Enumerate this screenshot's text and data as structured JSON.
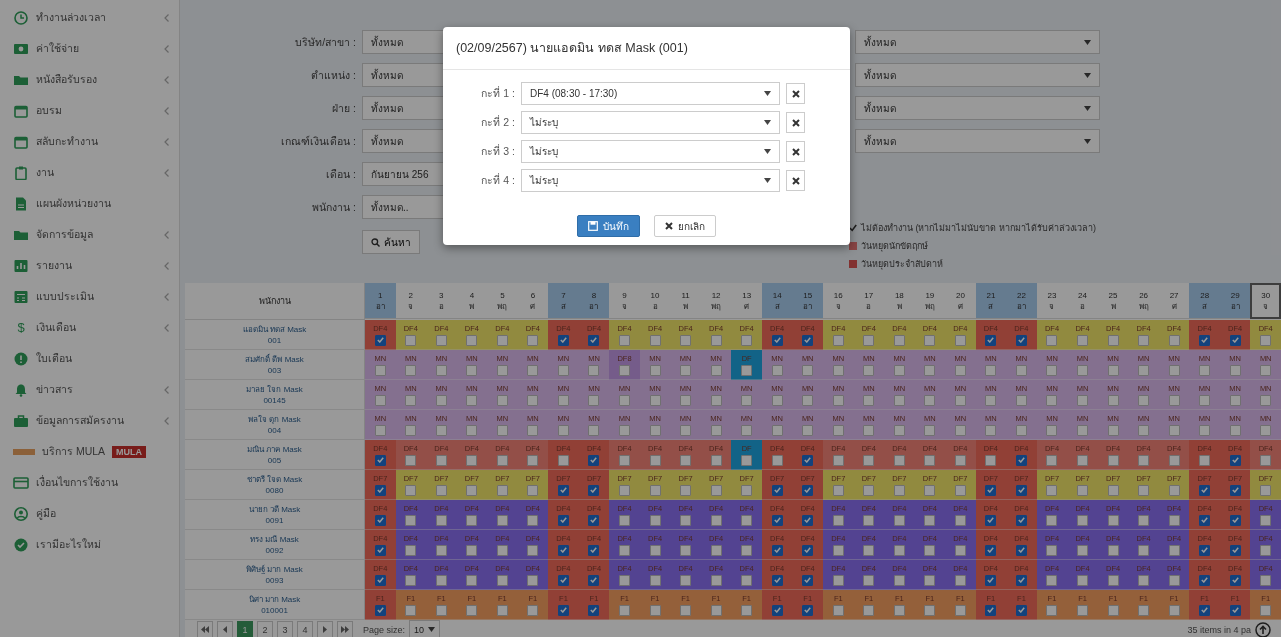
{
  "sidebar": {
    "items": [
      {
        "label": "ทำงานล่วงเวลา",
        "has_submenu": true
      },
      {
        "label": "ค่าใช้จ่าย",
        "has_submenu": true
      },
      {
        "label": "หนังสือรับรอง",
        "has_submenu": true
      },
      {
        "label": "อบรม",
        "has_submenu": true
      },
      {
        "label": "สลับกะทำงาน",
        "has_submenu": true
      },
      {
        "label": "งาน",
        "has_submenu": true
      },
      {
        "label": "แผนผังหน่วยงาน",
        "has_submenu": false
      },
      {
        "label": "จัดการข้อมูล",
        "has_submenu": true
      },
      {
        "label": "รายงาน",
        "has_submenu": true
      },
      {
        "label": "แบบประเมิน",
        "has_submenu": true
      },
      {
        "label": "เงินเดือน",
        "has_submenu": true,
        "glyph": "$"
      },
      {
        "label": "ใบเตือน",
        "has_submenu": false
      },
      {
        "label": "ข่าวสาร",
        "has_submenu": true
      },
      {
        "label": "ข้อมูลการสมัครงาน",
        "has_submenu": true
      },
      {
        "label": "บริการ MULA",
        "has_submenu": false,
        "badge": "MULA"
      },
      {
        "label": "เงื่อนไขการใช้งาน",
        "has_submenu": false
      },
      {
        "label": "คู่มือ",
        "has_submenu": false
      },
      {
        "label": "เรามีอะไรใหม่",
        "has_submenu": false
      }
    ]
  },
  "filters": {
    "left": [
      {
        "label": "บริษัท/สาขา :",
        "value": "ทั้งหมด"
      },
      {
        "label": "ตำแหน่ง :",
        "value": "ทั้งหมด"
      },
      {
        "label": "ฝ่าย :",
        "value": "ทั้งหมด"
      },
      {
        "label": "เกณฑ์เงินเดือน :",
        "value": "ทั้งหมด"
      },
      {
        "label": "เดือน :",
        "value": "กันยายน 256"
      },
      {
        "label": "พนักงาน :",
        "value": "ทั้งหมด.."
      }
    ],
    "right": [
      {
        "value": "ทั้งหมด"
      },
      {
        "value": "ทั้งหมด"
      },
      {
        "value": "ทั้งหมด"
      },
      {
        "value": "ทั้งหมด"
      }
    ],
    "search_button": "ค้นหา"
  },
  "legend": [
    {
      "kind": "icon",
      "text": "ไม่ต้องทำงาน (หากไม่มาไม่นับขาด หากมาได้รับค่าล่วงเวลา)"
    },
    {
      "kind": "swatch",
      "color": "#894545",
      "text": "วันหยุดนักขัตฤกษ์"
    },
    {
      "kind": "swatch",
      "color": "#823230",
      "text": "วันหยุดประจำสัปดาห์"
    }
  ],
  "grid": {
    "name_header": "พนักงาน",
    "days": [
      {
        "day": "1",
        "weekday": "อา",
        "kind": "weekend"
      },
      {
        "day": "2",
        "weekday": "จ",
        "kind": "weekday"
      },
      {
        "day": "3",
        "weekday": "อ",
        "kind": "weekday"
      },
      {
        "day": "4",
        "weekday": "พ",
        "kind": "weekday"
      },
      {
        "day": "5",
        "weekday": "พฤ",
        "kind": "weekday"
      },
      {
        "day": "6",
        "weekday": "ศ",
        "kind": "weekday"
      },
      {
        "day": "7",
        "weekday": "ส",
        "kind": "weekend"
      },
      {
        "day": "8",
        "weekday": "อา",
        "kind": "weekend"
      },
      {
        "day": "9",
        "weekday": "จ",
        "kind": "weekday"
      },
      {
        "day": "10",
        "weekday": "อ",
        "kind": "weekday"
      },
      {
        "day": "11",
        "weekday": "พ",
        "kind": "weekday"
      },
      {
        "day": "12",
        "weekday": "พฤ",
        "kind": "weekday"
      },
      {
        "day": "13",
        "weekday": "ศ",
        "kind": "weekday"
      },
      {
        "day": "14",
        "weekday": "ส",
        "kind": "weekend"
      },
      {
        "day": "15",
        "weekday": "อา",
        "kind": "weekend"
      },
      {
        "day": "16",
        "weekday": "จ",
        "kind": "weekday"
      },
      {
        "day": "17",
        "weekday": "อ",
        "kind": "weekday"
      },
      {
        "day": "18",
        "weekday": "พ",
        "kind": "weekday"
      },
      {
        "day": "19",
        "weekday": "พฤ",
        "kind": "weekday"
      },
      {
        "day": "20",
        "weekday": "ศ",
        "kind": "weekday"
      },
      {
        "day": "21",
        "weekday": "ส",
        "kind": "weekend"
      },
      {
        "day": "22",
        "weekday": "อา",
        "kind": "weekend"
      },
      {
        "day": "23",
        "weekday": "จ",
        "kind": "weekday"
      },
      {
        "day": "24",
        "weekday": "อ",
        "kind": "weekday"
      },
      {
        "day": "25",
        "weekday": "พ",
        "kind": "weekday"
      },
      {
        "day": "26",
        "weekday": "พฤ",
        "kind": "weekday"
      },
      {
        "day": "27",
        "weekday": "ศ",
        "kind": "weekday"
      },
      {
        "day": "28",
        "weekday": "ส",
        "kind": "weekend"
      },
      {
        "day": "29",
        "weekday": "อา",
        "kind": "weekend"
      },
      {
        "day": "30",
        "weekday": "จ",
        "kind": "today"
      }
    ],
    "rows": [
      {
        "name": "แอดมิน ทดส Mask",
        "id": "001",
        "color": "#918a3f",
        "cells": [
          {
            "code": "DF4",
            "kind": "off",
            "checked": true
          },
          {
            "code": "DF4",
            "kind": "work",
            "checked": false
          },
          {
            "code": "DF4",
            "kind": "work",
            "checked": false
          },
          {
            "code": "DF4",
            "kind": "work",
            "checked": false
          },
          {
            "code": "DF4",
            "kind": "work",
            "checked": false
          },
          {
            "code": "DF4",
            "kind": "work",
            "checked": false
          },
          {
            "code": "DF4",
            "kind": "off",
            "checked": true
          },
          {
            "code": "DF4",
            "kind": "off",
            "checked": true
          },
          {
            "code": "DF4",
            "kind": "work",
            "checked": false
          },
          {
            "code": "DF4",
            "kind": "work",
            "checked": false
          },
          {
            "code": "DF4",
            "kind": "work",
            "checked": false
          },
          {
            "code": "DF4",
            "kind": "work",
            "checked": false
          },
          {
            "code": "DF4",
            "kind": "work",
            "checked": false
          },
          {
            "code": "DF4",
            "kind": "off",
            "checked": true
          },
          {
            "code": "DF4",
            "kind": "off",
            "checked": true
          },
          {
            "code": "DF4",
            "kind": "work",
            "checked": false
          },
          {
            "code": "DF4",
            "kind": "work",
            "checked": false
          },
          {
            "code": "DF4",
            "kind": "work",
            "checked": false
          },
          {
            "code": "DF4",
            "kind": "work",
            "checked": false
          },
          {
            "code": "DF4",
            "kind": "work",
            "checked": false
          },
          {
            "code": "DF4",
            "kind": "off",
            "checked": true
          },
          {
            "code": "DF4",
            "kind": "off",
            "checked": true
          },
          {
            "code": "DF4",
            "kind": "work",
            "checked": false
          },
          {
            "code": "DF4",
            "kind": "work",
            "checked": false
          },
          {
            "code": "DF4",
            "kind": "work",
            "checked": false
          },
          {
            "code": "DF4",
            "kind": "work",
            "checked": false
          },
          {
            "code": "DF4",
            "kind": "work",
            "checked": false
          },
          {
            "code": "DF4",
            "kind": "off",
            "checked": true
          },
          {
            "code": "DF4",
            "kind": "off",
            "checked": true
          },
          {
            "code": "DF4",
            "kind": "work",
            "checked": false
          }
        ]
      },
      {
        "name": "สมศักดิ์ ดีพ Mask",
        "id": "003",
        "color": "#84708f",
        "cells": [
          {
            "code": "MN",
            "kind": "work",
            "checked": false
          },
          {
            "code": "MN",
            "kind": "work",
            "checked": false
          },
          {
            "code": "MN",
            "kind": "work",
            "checked": false
          },
          {
            "code": "MN",
            "kind": "work",
            "checked": false
          },
          {
            "code": "MN",
            "kind": "work",
            "checked": false
          },
          {
            "code": "MN",
            "kind": "work",
            "checked": false
          },
          {
            "code": "MN",
            "kind": "work",
            "checked": false
          },
          {
            "code": "MN",
            "kind": "work",
            "checked": false
          },
          {
            "code": "DF8",
            "kind": "alt",
            "checked": false
          },
          {
            "code": "MN",
            "kind": "work",
            "checked": false
          },
          {
            "code": "MN",
            "kind": "work",
            "checked": false
          },
          {
            "code": "MN",
            "kind": "work",
            "checked": false
          },
          {
            "code": "DF",
            "kind": "marked",
            "checked": false
          },
          {
            "code": "MN",
            "kind": "work",
            "checked": false
          },
          {
            "code": "MN",
            "kind": "work",
            "checked": false
          },
          {
            "code": "MN",
            "kind": "work",
            "checked": false
          },
          {
            "code": "MN",
            "kind": "work",
            "checked": false
          },
          {
            "code": "MN",
            "kind": "work",
            "checked": false
          },
          {
            "code": "MN",
            "kind": "work",
            "checked": false
          },
          {
            "code": "MN",
            "kind": "work",
            "checked": false
          },
          {
            "code": "MN",
            "kind": "work",
            "checked": false
          },
          {
            "code": "MN",
            "kind": "work",
            "checked": false
          },
          {
            "code": "MN",
            "kind": "work",
            "checked": false
          },
          {
            "code": "MN",
            "kind": "work",
            "checked": false
          },
          {
            "code": "MN",
            "kind": "work",
            "checked": false
          },
          {
            "code": "MN",
            "kind": "work",
            "checked": false
          },
          {
            "code": "MN",
            "kind": "work",
            "checked": false
          },
          {
            "code": "MN",
            "kind": "work",
            "checked": false
          },
          {
            "code": "MN",
            "kind": "work",
            "checked": false
          },
          {
            "code": "MN",
            "kind": "work",
            "checked": false
          }
        ]
      },
      {
        "name": "มาลย ใจก Mask",
        "id": "00145",
        "color": "#84708f",
        "cells": [
          {
            "code": "MN",
            "kind": "work",
            "checked": false
          },
          {
            "code": "MN",
            "kind": "work",
            "checked": false
          },
          {
            "code": "MN",
            "kind": "work",
            "checked": false
          },
          {
            "code": "MN",
            "kind": "work",
            "checked": false
          },
          {
            "code": "MN",
            "kind": "work",
            "checked": false
          },
          {
            "code": "MN",
            "kind": "work",
            "checked": false
          },
          {
            "code": "MN",
            "kind": "work",
            "checked": false
          },
          {
            "code": "MN",
            "kind": "work",
            "checked": false
          },
          {
            "code": "MN",
            "kind": "work",
            "checked": false
          },
          {
            "code": "MN",
            "kind": "work",
            "checked": false
          },
          {
            "code": "MN",
            "kind": "work",
            "checked": false
          },
          {
            "code": "MN",
            "kind": "work",
            "checked": false
          },
          {
            "code": "MN",
            "kind": "work",
            "checked": false
          },
          {
            "code": "MN",
            "kind": "work",
            "checked": false
          },
          {
            "code": "MN",
            "kind": "work",
            "checked": false
          },
          {
            "code": "MN",
            "kind": "work",
            "checked": false
          },
          {
            "code": "MN",
            "kind": "work",
            "checked": false
          },
          {
            "code": "MN",
            "kind": "work",
            "checked": false
          },
          {
            "code": "MN",
            "kind": "work",
            "checked": false
          },
          {
            "code": "MN",
            "kind": "work",
            "checked": false
          },
          {
            "code": "MN",
            "kind": "work",
            "checked": false
          },
          {
            "code": "MN",
            "kind": "work",
            "checked": false
          },
          {
            "code": "MN",
            "kind": "work",
            "checked": false
          },
          {
            "code": "MN",
            "kind": "work",
            "checked": false
          },
          {
            "code": "MN",
            "kind": "work",
            "checked": false
          },
          {
            "code": "MN",
            "kind": "work",
            "checked": false
          },
          {
            "code": "MN",
            "kind": "work",
            "checked": false
          },
          {
            "code": "MN",
            "kind": "work",
            "checked": false
          },
          {
            "code": "MN",
            "kind": "work",
            "checked": false
          },
          {
            "code": "MN",
            "kind": "work",
            "checked": false
          }
        ]
      },
      {
        "name": "พลใจ ดุก Mask",
        "id": "004",
        "color": "#84708f",
        "cells": [
          {
            "code": "MN",
            "kind": "work",
            "checked": false
          },
          {
            "code": "MN",
            "kind": "work",
            "checked": false
          },
          {
            "code": "MN",
            "kind": "work",
            "checked": false
          },
          {
            "code": "MN",
            "kind": "work",
            "checked": false
          },
          {
            "code": "MN",
            "kind": "work",
            "checked": false
          },
          {
            "code": "MN",
            "kind": "work",
            "checked": false
          },
          {
            "code": "MN",
            "kind": "work",
            "checked": false
          },
          {
            "code": "MN",
            "kind": "work",
            "checked": false
          },
          {
            "code": "MN",
            "kind": "work",
            "checked": false
          },
          {
            "code": "MN",
            "kind": "work",
            "checked": false
          },
          {
            "code": "MN",
            "kind": "work",
            "checked": false
          },
          {
            "code": "MN",
            "kind": "work",
            "checked": false
          },
          {
            "code": "MN",
            "kind": "work",
            "checked": false
          },
          {
            "code": "MN",
            "kind": "work",
            "checked": false
          },
          {
            "code": "MN",
            "kind": "work",
            "checked": false
          },
          {
            "code": "MN",
            "kind": "work",
            "checked": false
          },
          {
            "code": "MN",
            "kind": "work",
            "checked": false
          },
          {
            "code": "MN",
            "kind": "work",
            "checked": false
          },
          {
            "code": "MN",
            "kind": "work",
            "checked": false
          },
          {
            "code": "MN",
            "kind": "work",
            "checked": false
          },
          {
            "code": "MN",
            "kind": "work",
            "checked": false
          },
          {
            "code": "MN",
            "kind": "work",
            "checked": false
          },
          {
            "code": "MN",
            "kind": "work",
            "checked": false
          },
          {
            "code": "MN",
            "kind": "work",
            "checked": false
          },
          {
            "code": "MN",
            "kind": "work",
            "checked": false
          },
          {
            "code": "MN",
            "kind": "work",
            "checked": false
          },
          {
            "code": "MN",
            "kind": "work",
            "checked": false
          },
          {
            "code": "MN",
            "kind": "work",
            "checked": false
          },
          {
            "code": "MN",
            "kind": "work",
            "checked": false
          },
          {
            "code": "MN",
            "kind": "work",
            "checked": false
          }
        ]
      },
      {
        "name": "มณิน ภาค Mask",
        "id": "005",
        "color": "#934f48",
        "cells": [
          {
            "code": "DF4",
            "kind": "off",
            "checked": true
          },
          {
            "code": "DF4",
            "kind": "work",
            "checked": false
          },
          {
            "code": "DF4",
            "kind": "work",
            "checked": false
          },
          {
            "code": "DF4",
            "kind": "work",
            "checked": false
          },
          {
            "code": "DF4",
            "kind": "work",
            "checked": false
          },
          {
            "code": "DF4",
            "kind": "work",
            "checked": false
          },
          {
            "code": "DF4",
            "kind": "off",
            "checked": false
          },
          {
            "code": "DF4",
            "kind": "off",
            "checked": true
          },
          {
            "code": "DF4",
            "kind": "work",
            "checked": false
          },
          {
            "code": "DF4",
            "kind": "work",
            "checked": false
          },
          {
            "code": "DF4",
            "kind": "work",
            "checked": false
          },
          {
            "code": "DF4",
            "kind": "work",
            "checked": false
          },
          {
            "code": "DF",
            "kind": "marked",
            "checked": false
          },
          {
            "code": "DF4",
            "kind": "off",
            "checked": false
          },
          {
            "code": "DF4",
            "kind": "off",
            "checked": true
          },
          {
            "code": "DF4",
            "kind": "work",
            "checked": false
          },
          {
            "code": "DF4",
            "kind": "work",
            "checked": false
          },
          {
            "code": "DF4",
            "kind": "work",
            "checked": false
          },
          {
            "code": "DF4",
            "kind": "work",
            "checked": false
          },
          {
            "code": "DF4",
            "kind": "work",
            "checked": false
          },
          {
            "code": "DF4",
            "kind": "off",
            "checked": false
          },
          {
            "code": "DF4",
            "kind": "off",
            "checked": true
          },
          {
            "code": "DF4",
            "kind": "work",
            "checked": false
          },
          {
            "code": "DF4",
            "kind": "work",
            "checked": false
          },
          {
            "code": "DF4",
            "kind": "work",
            "checked": false
          },
          {
            "code": "DF4",
            "kind": "work",
            "checked": false
          },
          {
            "code": "DF4",
            "kind": "work",
            "checked": false
          },
          {
            "code": "DF4",
            "kind": "off",
            "checked": false
          },
          {
            "code": "DF4",
            "kind": "off",
            "checked": true
          },
          {
            "code": "DF4",
            "kind": "work",
            "checked": false
          }
        ]
      },
      {
        "name": "ชาตรี ใจด Mask",
        "id": "0080",
        "color": "#918a3f",
        "cells": [
          {
            "code": "DF7",
            "kind": "off",
            "checked": true
          },
          {
            "code": "DF7",
            "kind": "work",
            "checked": false
          },
          {
            "code": "DF7",
            "kind": "work",
            "checked": false
          },
          {
            "code": "DF7",
            "kind": "work",
            "checked": false
          },
          {
            "code": "DF7",
            "kind": "work",
            "checked": false
          },
          {
            "code": "DF7",
            "kind": "work",
            "checked": false
          },
          {
            "code": "DF7",
            "kind": "off",
            "checked": true
          },
          {
            "code": "DF7",
            "kind": "off",
            "checked": true
          },
          {
            "code": "DF7",
            "kind": "work",
            "checked": false
          },
          {
            "code": "DF7",
            "kind": "work",
            "checked": false
          },
          {
            "code": "DF7",
            "kind": "work",
            "checked": false
          },
          {
            "code": "DF7",
            "kind": "work",
            "checked": false
          },
          {
            "code": "DF7",
            "kind": "work",
            "checked": false
          },
          {
            "code": "DF7",
            "kind": "off",
            "checked": true
          },
          {
            "code": "DF7",
            "kind": "off",
            "checked": true
          },
          {
            "code": "DF7",
            "kind": "work",
            "checked": false
          },
          {
            "code": "DF7",
            "kind": "work",
            "checked": false
          },
          {
            "code": "DF7",
            "kind": "work",
            "checked": false
          },
          {
            "code": "DF7",
            "kind": "work",
            "checked": false
          },
          {
            "code": "DF7",
            "kind": "work",
            "checked": false
          },
          {
            "code": "DF7",
            "kind": "off",
            "checked": true
          },
          {
            "code": "DF7",
            "kind": "off",
            "checked": true
          },
          {
            "code": "DF7",
            "kind": "work",
            "checked": false
          },
          {
            "code": "DF7",
            "kind": "work",
            "checked": false
          },
          {
            "code": "DF7",
            "kind": "work",
            "checked": false
          },
          {
            "code": "DF7",
            "kind": "work",
            "checked": false
          },
          {
            "code": "DF7",
            "kind": "work",
            "checked": false
          },
          {
            "code": "DF7",
            "kind": "off",
            "checked": true
          },
          {
            "code": "DF7",
            "kind": "off",
            "checked": true
          },
          {
            "code": "DF7",
            "kind": "work",
            "checked": false
          }
        ]
      },
      {
        "name": "นายก วดี Mask",
        "id": "0091",
        "color": "#534491",
        "cells": [
          {
            "code": "DF4",
            "kind": "off",
            "checked": true
          },
          {
            "code": "DF4",
            "kind": "work",
            "checked": false
          },
          {
            "code": "DF4",
            "kind": "work",
            "checked": false
          },
          {
            "code": "DF4",
            "kind": "work",
            "checked": false
          },
          {
            "code": "DF4",
            "kind": "work",
            "checked": false
          },
          {
            "code": "DF4",
            "kind": "work",
            "checked": false
          },
          {
            "code": "DF4",
            "kind": "off",
            "checked": true
          },
          {
            "code": "DF4",
            "kind": "off",
            "checked": true
          },
          {
            "code": "DF4",
            "kind": "work",
            "checked": false
          },
          {
            "code": "DF4",
            "kind": "work",
            "checked": false
          },
          {
            "code": "DF4",
            "kind": "work",
            "checked": false
          },
          {
            "code": "DF4",
            "kind": "work",
            "checked": false
          },
          {
            "code": "DF4",
            "kind": "work",
            "checked": false
          },
          {
            "code": "DF4",
            "kind": "off",
            "checked": true
          },
          {
            "code": "DF4",
            "kind": "off",
            "checked": true
          },
          {
            "code": "DF4",
            "kind": "work",
            "checked": false
          },
          {
            "code": "DF4",
            "kind": "work",
            "checked": false
          },
          {
            "code": "DF4",
            "kind": "work",
            "checked": false
          },
          {
            "code": "DF4",
            "kind": "work",
            "checked": false
          },
          {
            "code": "DF4",
            "kind": "work",
            "checked": false
          },
          {
            "code": "DF4",
            "kind": "off",
            "checked": true
          },
          {
            "code": "DF4",
            "kind": "off",
            "checked": true
          },
          {
            "code": "DF4",
            "kind": "work",
            "checked": false
          },
          {
            "code": "DF4",
            "kind": "work",
            "checked": false
          },
          {
            "code": "DF4",
            "kind": "work",
            "checked": false
          },
          {
            "code": "DF4",
            "kind": "work",
            "checked": false
          },
          {
            "code": "DF4",
            "kind": "work",
            "checked": false
          },
          {
            "code": "DF4",
            "kind": "off",
            "checked": true
          },
          {
            "code": "DF4",
            "kind": "off",
            "checked": true
          },
          {
            "code": "DF4",
            "kind": "work",
            "checked": false
          }
        ]
      },
      {
        "name": "ทรง มณี Mask",
        "id": "0092",
        "color": "#534491",
        "cells": [
          {
            "code": "DF4",
            "kind": "off",
            "checked": true
          },
          {
            "code": "DF4",
            "kind": "work",
            "checked": false
          },
          {
            "code": "DF4",
            "kind": "work",
            "checked": false
          },
          {
            "code": "DF4",
            "kind": "work",
            "checked": false
          },
          {
            "code": "DF4",
            "kind": "work",
            "checked": false
          },
          {
            "code": "DF4",
            "kind": "work",
            "checked": false
          },
          {
            "code": "DF4",
            "kind": "off",
            "checked": true
          },
          {
            "code": "DF4",
            "kind": "off",
            "checked": true
          },
          {
            "code": "DF4",
            "kind": "work",
            "checked": false
          },
          {
            "code": "DF4",
            "kind": "work",
            "checked": false
          },
          {
            "code": "DF4",
            "kind": "work",
            "checked": false
          },
          {
            "code": "DF4",
            "kind": "work",
            "checked": false
          },
          {
            "code": "DF4",
            "kind": "work",
            "checked": false
          },
          {
            "code": "DF4",
            "kind": "off",
            "checked": true
          },
          {
            "code": "DF4",
            "kind": "off",
            "checked": true
          },
          {
            "code": "DF4",
            "kind": "work",
            "checked": false
          },
          {
            "code": "DF4",
            "kind": "work",
            "checked": false
          },
          {
            "code": "DF4",
            "kind": "work",
            "checked": false
          },
          {
            "code": "DF4",
            "kind": "work",
            "checked": false
          },
          {
            "code": "DF4",
            "kind": "work",
            "checked": false
          },
          {
            "code": "DF4",
            "kind": "off",
            "checked": true
          },
          {
            "code": "DF4",
            "kind": "off",
            "checked": true
          },
          {
            "code": "DF4",
            "kind": "work",
            "checked": false
          },
          {
            "code": "DF4",
            "kind": "work",
            "checked": false
          },
          {
            "code": "DF4",
            "kind": "work",
            "checked": false
          },
          {
            "code": "DF4",
            "kind": "work",
            "checked": false
          },
          {
            "code": "DF4",
            "kind": "work",
            "checked": false
          },
          {
            "code": "DF4",
            "kind": "off",
            "checked": true
          },
          {
            "code": "DF4",
            "kind": "off",
            "checked": true
          },
          {
            "code": "DF4",
            "kind": "work",
            "checked": false
          }
        ]
      },
      {
        "name": "พิศิษฐ์ มาก Mask",
        "id": "0093",
        "color": "#534491",
        "cells": [
          {
            "code": "DF4",
            "kind": "off",
            "checked": true
          },
          {
            "code": "DF4",
            "kind": "work",
            "checked": false
          },
          {
            "code": "DF4",
            "kind": "work",
            "checked": false
          },
          {
            "code": "DF4",
            "kind": "work",
            "checked": false
          },
          {
            "code": "DF4",
            "kind": "work",
            "checked": false
          },
          {
            "code": "DF4",
            "kind": "work",
            "checked": false
          },
          {
            "code": "DF4",
            "kind": "off",
            "checked": true
          },
          {
            "code": "DF4",
            "kind": "off",
            "checked": true
          },
          {
            "code": "DF4",
            "kind": "work",
            "checked": false
          },
          {
            "code": "DF4",
            "kind": "work",
            "checked": false
          },
          {
            "code": "DF4",
            "kind": "work",
            "checked": false
          },
          {
            "code": "DF4",
            "kind": "work",
            "checked": false
          },
          {
            "code": "DF4",
            "kind": "work",
            "checked": false
          },
          {
            "code": "DF4",
            "kind": "off",
            "checked": true
          },
          {
            "code": "DF4",
            "kind": "off",
            "checked": true
          },
          {
            "code": "DF4",
            "kind": "work",
            "checked": false
          },
          {
            "code": "DF4",
            "kind": "work",
            "checked": false
          },
          {
            "code": "DF4",
            "kind": "work",
            "checked": false
          },
          {
            "code": "DF4",
            "kind": "work",
            "checked": false
          },
          {
            "code": "DF4",
            "kind": "work",
            "checked": false
          },
          {
            "code": "DF4",
            "kind": "off",
            "checked": true
          },
          {
            "code": "DF4",
            "kind": "off",
            "checked": true
          },
          {
            "code": "DF4",
            "kind": "work",
            "checked": false
          },
          {
            "code": "DF4",
            "kind": "work",
            "checked": false
          },
          {
            "code": "DF4",
            "kind": "work",
            "checked": false
          },
          {
            "code": "DF4",
            "kind": "work",
            "checked": false
          },
          {
            "code": "DF4",
            "kind": "work",
            "checked": false
          },
          {
            "code": "DF4",
            "kind": "off",
            "checked": true
          },
          {
            "code": "DF4",
            "kind": "off",
            "checked": true
          },
          {
            "code": "DF4",
            "kind": "work",
            "checked": false
          }
        ]
      },
      {
        "name": "นิศา มาก Mask",
        "id": "010001",
        "color": "#94603a",
        "cells": [
          {
            "code": "F1",
            "kind": "off",
            "checked": true
          },
          {
            "code": "F1",
            "kind": "work",
            "checked": false
          },
          {
            "code": "F1",
            "kind": "work",
            "checked": false
          },
          {
            "code": "F1",
            "kind": "work",
            "checked": false
          },
          {
            "code": "F1",
            "kind": "work",
            "checked": false
          },
          {
            "code": "F1",
            "kind": "work",
            "checked": false
          },
          {
            "code": "F1",
            "kind": "off",
            "checked": true
          },
          {
            "code": "F1",
            "kind": "off",
            "checked": true
          },
          {
            "code": "F1",
            "kind": "work",
            "checked": false
          },
          {
            "code": "F1",
            "kind": "work",
            "checked": false
          },
          {
            "code": "F1",
            "kind": "work",
            "checked": false
          },
          {
            "code": "F1",
            "kind": "work",
            "checked": false
          },
          {
            "code": "F1",
            "kind": "work",
            "checked": false
          },
          {
            "code": "F1",
            "kind": "off",
            "checked": true
          },
          {
            "code": "F1",
            "kind": "off",
            "checked": true
          },
          {
            "code": "F1",
            "kind": "work",
            "checked": false
          },
          {
            "code": "F1",
            "kind": "work",
            "checked": false
          },
          {
            "code": "F1",
            "kind": "work",
            "checked": false
          },
          {
            "code": "F1",
            "kind": "work",
            "checked": false
          },
          {
            "code": "F1",
            "kind": "work",
            "checked": false
          },
          {
            "code": "F1",
            "kind": "off",
            "checked": true
          },
          {
            "code": "F1",
            "kind": "off",
            "checked": true
          },
          {
            "code": "F1",
            "kind": "work",
            "checked": false
          },
          {
            "code": "F1",
            "kind": "work",
            "checked": false
          },
          {
            "code": "F1",
            "kind": "work",
            "checked": false
          },
          {
            "code": "F1",
            "kind": "work",
            "checked": false
          },
          {
            "code": "F1",
            "kind": "work",
            "checked": false
          },
          {
            "code": "F1",
            "kind": "off",
            "checked": true
          },
          {
            "code": "F1",
            "kind": "off",
            "checked": true
          },
          {
            "code": "F1",
            "kind": "work",
            "checked": false
          }
        ]
      }
    ]
  },
  "pagination": {
    "pages": [
      {
        "label": "1",
        "selected": true
      },
      {
        "label": "2",
        "selected": false
      },
      {
        "label": "3",
        "selected": false
      },
      {
        "label": "4",
        "selected": false
      }
    ],
    "page_size_label": "Page size:",
    "page_size": "10",
    "summary": "35 items in 4 pa"
  },
  "modal": {
    "title": "(02/09/2567) นายแอดมิน ทดส Mask (001)",
    "rows": [
      {
        "label": "กะที่ 1 :",
        "value": "DF4 (08:30 - 17:30)"
      },
      {
        "label": "กะที่ 2 :",
        "value": "ไม่ระบุ"
      },
      {
        "label": "กะที่ 3 :",
        "value": "ไม่ระบุ"
      },
      {
        "label": "กะที่ 4 :",
        "value": "ไม่ระบุ"
      }
    ],
    "buttons": [
      {
        "label": "บันทึก",
        "kind": "primary"
      },
      {
        "label": "ยกเลิก",
        "kind": "cancel"
      }
    ]
  }
}
